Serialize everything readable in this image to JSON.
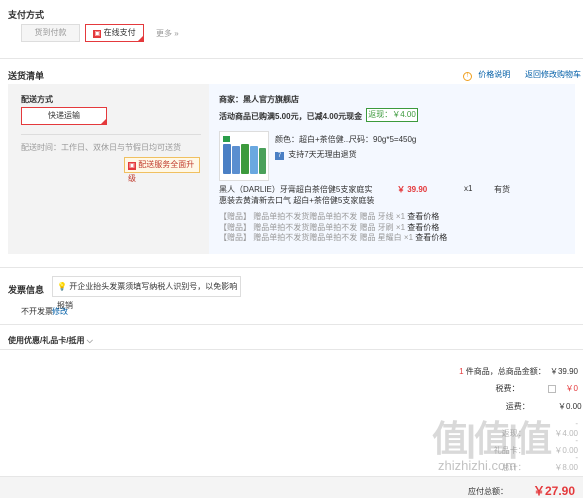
{
  "payment": {
    "title": "支付方式",
    "cod_label": "货到付款",
    "online_label": "在线支付",
    "more_label": "更多 »"
  },
  "delivery_list": {
    "title": "送货清单",
    "price_note": "价格说明",
    "back_to_cart": "返回修改购物车",
    "method_title": "配送方式",
    "method_value": "快递运输",
    "time_text": "配送时间：工作日、双休日与节假日均可送货",
    "upgrade_label": "配送服务全面升级"
  },
  "seller": {
    "label": "商家：黑人官方旗舰店",
    "promo_text": "活动商品已购满5.00元，已减4.00元现金",
    "promo_badge": "返现：￥4.00"
  },
  "product": {
    "color_text": "颜色：超白+茶倍健...",
    "size_text": "尺码：90g*5=450g",
    "return_text": "支持7天无理由退货",
    "name_line1": "黑人（DARLIE）牙膏超白茶倍健5支家庭实",
    "name_line2": "惠装去黄清新去口气 超白+茶倍健5支家庭装",
    "price": "￥ 39.90",
    "qty": "x1",
    "stock": "有货",
    "gifts": [
      {
        "tag": "【赠品】",
        "name": "赠品单拍不发货赠品单拍不发 赠品 牙线",
        "qty": "×1",
        "link": "查看价格"
      },
      {
        "tag": "【赠品】",
        "name": "赠品单拍不发货赠品单拍不发 赠品 牙刷",
        "qty": "×1",
        "link": "查看价格"
      },
      {
        "tag": "【赠品】",
        "name": "赠品单拍不发货赠品单拍不发 赠品 星耀白",
        "qty": "×1",
        "link": "查看价格"
      }
    ]
  },
  "invoice": {
    "title": "发票信息",
    "tip": "开企业抬头发票须填写纳税人识别号，以免影响报销",
    "status": "不开发票",
    "edit": "修改"
  },
  "coupon": {
    "title": "使用优惠/礼品卡/抵用"
  },
  "summary": {
    "count_num": "1",
    "count_label": "件商品，总商品金额：",
    "total_goods": "￥39.90",
    "tax_label": "税费：",
    "tax_value": "￥0",
    "freight_label": "运费：",
    "freight_value": "￥0.00",
    "row4_label": "返现：",
    "row4_value": "-￥4.00",
    "row5_label": "礼品卡：",
    "row5_value": "-￥0.00",
    "row6_label": "总计：",
    "row6_value": "-￥8.00",
    "payable_label": "应付总额：",
    "payable_value": "￥27.90"
  },
  "watermark": {
    "text": "值|值|值",
    "site": "zhizhizhi.com"
  }
}
